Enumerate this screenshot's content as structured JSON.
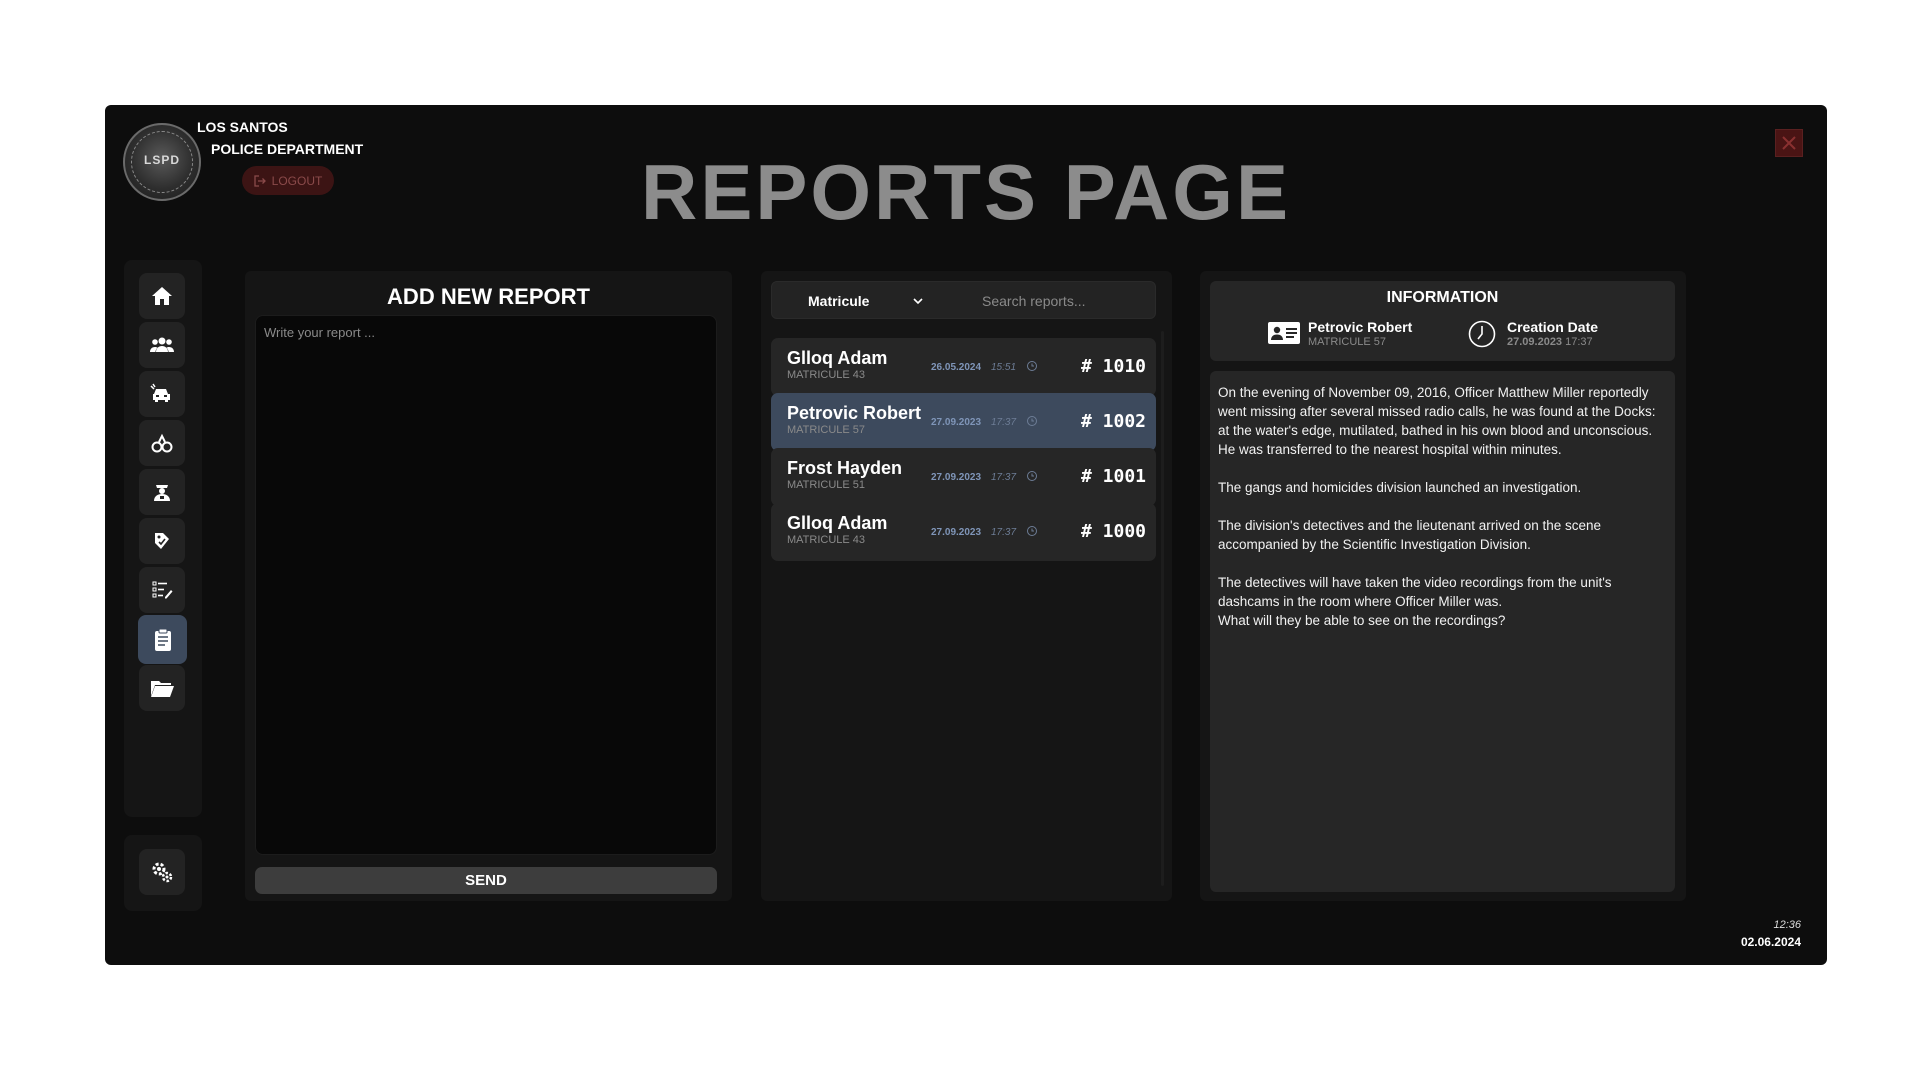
{
  "header": {
    "dept_line1": "LOS SANTOS",
    "dept_line2": "POLICE DEPARTMENT",
    "badge_text": "LSPD",
    "logout_label": "LOGOUT",
    "page_title": "REPORTS PAGE",
    "close_icon": "close-icon"
  },
  "sidebar": {
    "items": [
      {
        "icon": "home-icon",
        "active": false
      },
      {
        "icon": "people-icon",
        "active": false
      },
      {
        "icon": "vehicle-icon",
        "active": false
      },
      {
        "icon": "handcuffs-icon",
        "active": false
      },
      {
        "icon": "officer-icon",
        "active": false
      },
      {
        "icon": "tag-icon",
        "active": false
      },
      {
        "icon": "checklist-icon",
        "active": false
      },
      {
        "icon": "clipboard-icon",
        "active": true
      },
      {
        "icon": "folder-icon",
        "active": false
      }
    ],
    "settings_icon": "gear-icon"
  },
  "add_report": {
    "title": "ADD NEW REPORT",
    "placeholder": "Write your report ...",
    "send_label": "SEND"
  },
  "report_list": {
    "filter_label": "Matricule",
    "search_placeholder": "Search reports...",
    "rows": [
      {
        "name": "Glloq Adam",
        "matricule": "MATRICULE 43",
        "date": "26.05.2024",
        "time": "15:51",
        "number": "# 1010",
        "selected": false
      },
      {
        "name": "Petrovic Robert",
        "matricule": "MATRICULE 57",
        "date": "27.09.2023",
        "time": "17:37",
        "number": "# 1002",
        "selected": true
      },
      {
        "name": "Frost Hayden",
        "matricule": "MATRICULE 51",
        "date": "27.09.2023",
        "time": "17:37",
        "number": "# 1001",
        "selected": false
      },
      {
        "name": "Glloq Adam",
        "matricule": "MATRICULE 43",
        "date": "27.09.2023",
        "time": "17:37",
        "number": "# 1000",
        "selected": false
      }
    ]
  },
  "information": {
    "title": "INFORMATION",
    "officer_name": "Petrovic Robert",
    "officer_matricule": "MATRICULE 57",
    "creation_label": "Creation Date",
    "creation_date": "27.09.2023",
    "creation_time": "17:37",
    "paragraphs": [
      "On the evening of November 09, 2016, Officer Matthew Miller reportedly went missing after several missed radio calls, he was found at the Docks: at the water's edge, mutilated, bathed in his own blood and unconscious. He was transferred to the nearest hospital within minutes.",
      "The gangs and homicides division launched an investigation.",
      "The division's detectives and the lieutenant arrived on the scene accompanied by the Scientific Investigation Division.",
      "The detectives will have taken the video recordings from the unit's dashcams in the room where Officer Miller was.\nWhat will they be able to see on the recordings?"
    ]
  },
  "clock": {
    "time": "12:36",
    "date": "02.06.2024"
  },
  "colors": {
    "background": "#0d0d0d",
    "panel": "#151515",
    "card": "#262626",
    "selected": "#3d4a5d",
    "logout": "#3c1414",
    "close": "#4a1414"
  }
}
